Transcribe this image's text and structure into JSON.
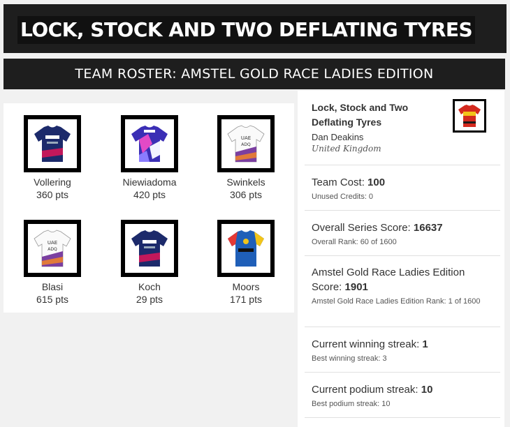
{
  "header": {
    "title": "LOCK, STOCK AND TWO DEFLATING TYRES"
  },
  "subheader": {
    "title": "TEAM ROSTER: AMSTEL GOLD RACE LADIES EDITION"
  },
  "roster": [
    {
      "name": "Vollering",
      "points": "360 pts",
      "jersey": "fdj-suez-jersey-icon"
    },
    {
      "name": "Niewiadoma",
      "points": "420 pts",
      "jersey": "canyon-sram-jersey-icon"
    },
    {
      "name": "Swinkels",
      "points": "306 pts",
      "jersey": "uae-adq-jersey-icon"
    },
    {
      "name": "Blasi",
      "points": "615 pts",
      "jersey": "uae-adq-jersey-icon"
    },
    {
      "name": "Koch",
      "points": "29 pts",
      "jersey": "fdj-suez-jersey-icon"
    },
    {
      "name": "Moors",
      "points": "171 pts",
      "jersey": "lidl-trek-jersey-icon"
    }
  ],
  "team": {
    "name": "Lock, Stock and Two Deflating Tyres",
    "manager": "Dan Deakins",
    "country": "United Kingdom",
    "jersey": "team-jersey-icon"
  },
  "stats": {
    "team_cost_label": "Team Cost: ",
    "team_cost_value": "100",
    "unused_credits": "Unused Credits: 0",
    "series_label": "Overall Series Score: ",
    "series_value": "16637",
    "series_rank": "Overall Rank: 60 of 1600",
    "race_label": "Amstel Gold Race Ladies Edition Score: ",
    "race_value": "1901",
    "race_rank": "Amstel Gold Race Ladies Edition Rank: 1 of 1600",
    "win_streak_label": "Current winning streak: ",
    "win_streak_value": "1",
    "best_win_streak": "Best winning streak: 3",
    "podium_streak_label": "Current podium streak: ",
    "podium_streak_value": "10",
    "best_podium_streak": "Best podium streak: 10"
  },
  "colors": {
    "header_bg": "#1e1e1e",
    "fdj_navy": "#1c2a6b",
    "uae_purple": "#7b3fa0",
    "lidl_blue": "#1f5fb8",
    "team_red": "#d42a1f",
    "team_yellow": "#f2c41a"
  }
}
